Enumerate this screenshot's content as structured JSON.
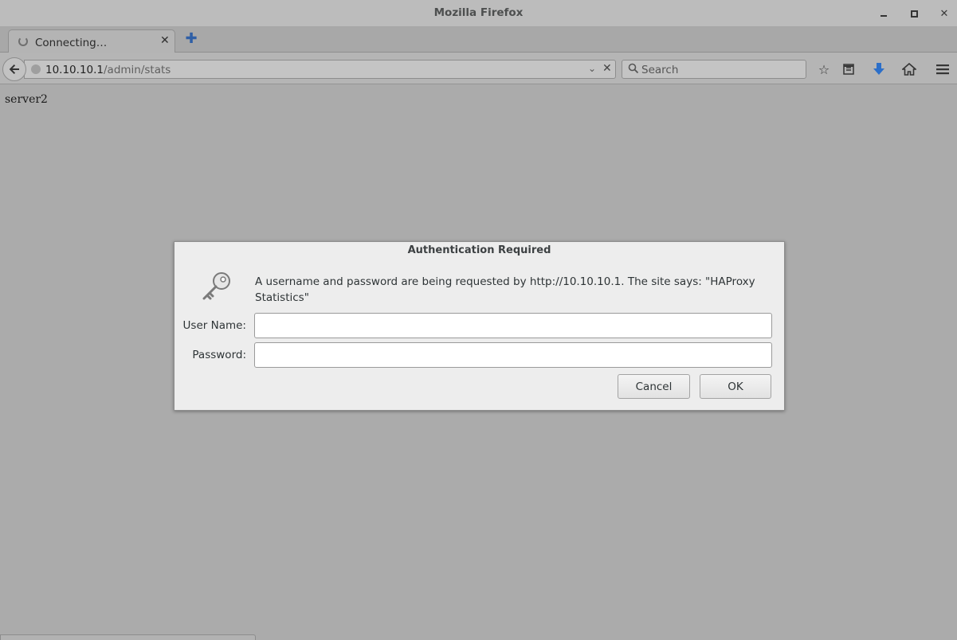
{
  "window": {
    "title": "Mozilla Firefox"
  },
  "tab": {
    "label": "Connecting…"
  },
  "navbar": {
    "url_host": "10.10.10.1",
    "url_path": "/admin/stats",
    "search_placeholder": "Search"
  },
  "page": {
    "text": "server2"
  },
  "dialog": {
    "title": "Authentication Required",
    "message": "A username and password are being requested by http://10.10.10.1. The site says: \"HAProxy Statistics\"",
    "username_label": "User Name:",
    "password_label": "Password:",
    "username_value": "",
    "password_value": "",
    "cancel_label": "Cancel",
    "ok_label": "OK"
  },
  "colors": {
    "download_arrow": "#2c6fc9",
    "newtab_plus": "#2f5fa6"
  }
}
